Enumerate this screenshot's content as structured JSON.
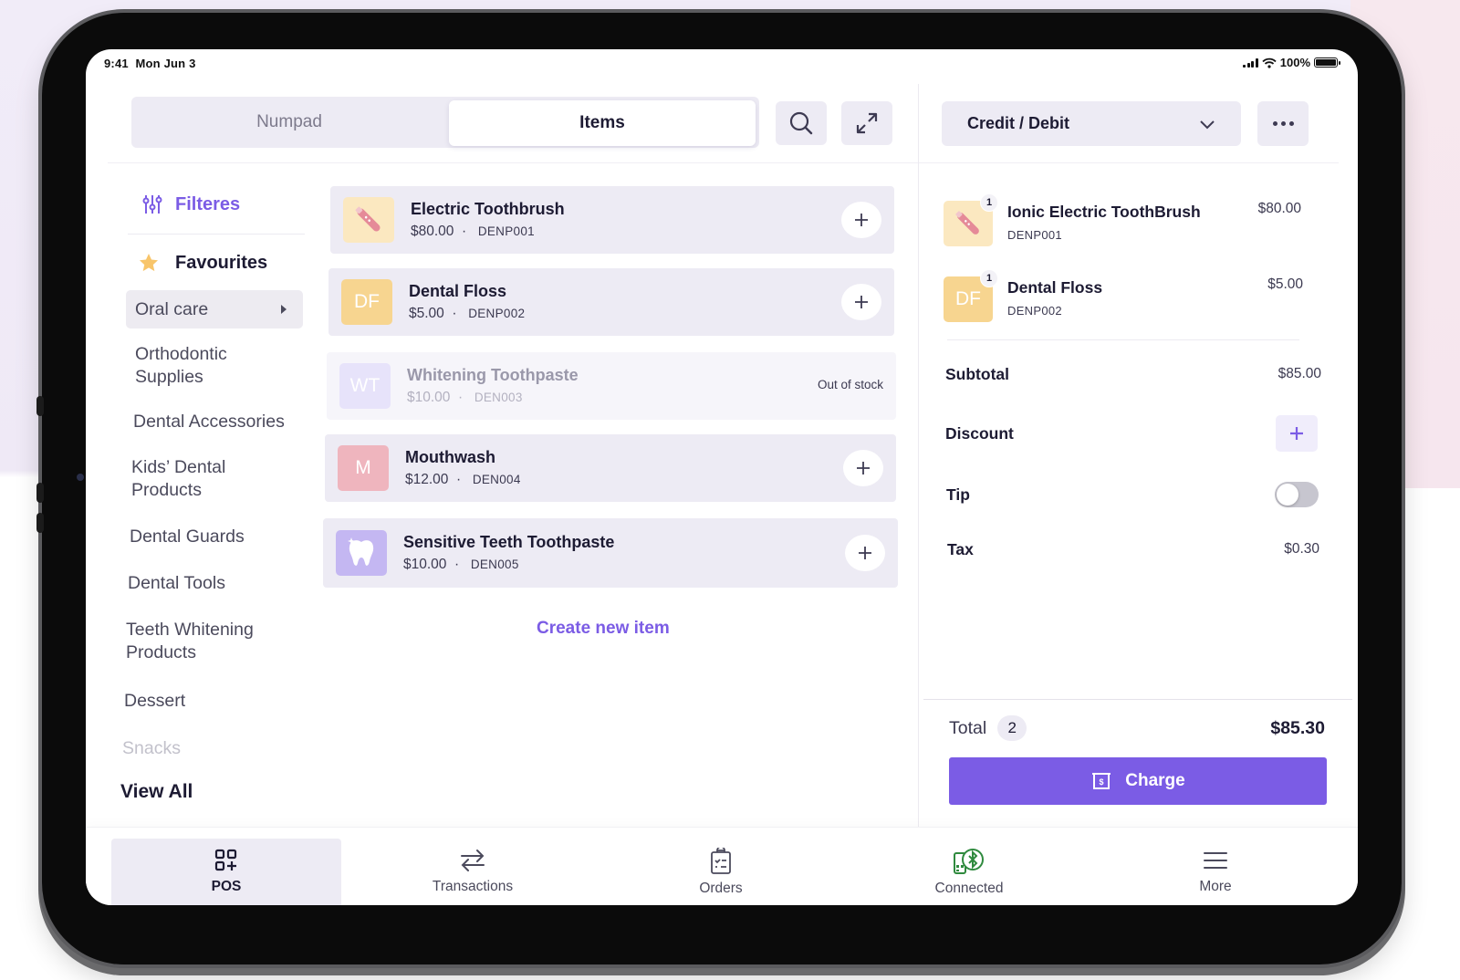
{
  "status_bar": {
    "time": "9:41",
    "date": "Mon Jun 3",
    "battery": "100%"
  },
  "top_bar": {
    "tabs": [
      {
        "label": "Numpad",
        "active": false
      },
      {
        "label": "Items",
        "active": true
      }
    ],
    "search_icon": "search-icon",
    "expand_icon": "expand-arrows-icon"
  },
  "payment": {
    "selected": "Credit / Debit",
    "more_icon": "ellipsis-icon"
  },
  "sidebar": {
    "filters_label": "Filteres",
    "favourites_label": "Favourites",
    "categories": [
      {
        "label": "Oral care",
        "active": true
      },
      {
        "label": "Orthodontic Supplies"
      },
      {
        "label": "Dental Accessories"
      },
      {
        "label": "Kids’ Dental Products"
      },
      {
        "label": "Dental Guards"
      },
      {
        "label": "Dental Tools"
      },
      {
        "label": "Teeth Whitening Products"
      },
      {
        "label": "Dessert"
      },
      {
        "label": "Snacks"
      }
    ],
    "view_all": "View All"
  },
  "products": [
    {
      "name": "Electric Toothbrush",
      "price": "$80.00",
      "sku": "DENP001",
      "thumb": "toothbrush-image",
      "initials": "",
      "color": "#fbe8c0",
      "in_stock": true
    },
    {
      "name": "Dental Floss",
      "price": "$5.00",
      "sku": "DENP002",
      "initials": "DF",
      "color": "#f7d590",
      "in_stock": true
    },
    {
      "name": "Whitening Toothpaste",
      "price": "$10.00",
      "sku": "DEN003",
      "initials": "WT",
      "color": "#e7e3fa",
      "in_stock": false,
      "status": "Out of stock"
    },
    {
      "name": "Mouthwash",
      "price": "$12.00",
      "sku": "DEN004",
      "initials": "M",
      "color": "#efb5be",
      "in_stock": true
    },
    {
      "name": "Sensitive Teeth Toothpaste",
      "price": "$10.00",
      "sku": "DEN005",
      "thumb": "tooth-image",
      "initials": "",
      "color": "#c4b7f2",
      "in_stock": true
    }
  ],
  "create_item": "Create new item",
  "cart": {
    "items": [
      {
        "name": "Ionic Electric ToothBrush",
        "sku": "DENP001",
        "price": "$80.00",
        "qty": "1"
      },
      {
        "name": "Dental Floss",
        "sku": "DENP002",
        "price": "$5.00",
        "qty": "1",
        "initials": "DF"
      }
    ],
    "subtotal_label": "Subtotal",
    "subtotal": "$85.00",
    "discount_label": "Discount",
    "tip_label": "Tip",
    "tip_enabled": false,
    "tax_label": "Tax",
    "tax": "$0.30",
    "total_label": "Total",
    "count": "2",
    "total": "$85.30",
    "charge_label": "Charge"
  },
  "bottom_nav": [
    {
      "label": "POS",
      "icon": "pos-grid-icon",
      "active": true
    },
    {
      "label": "Transactions",
      "icon": "swap-arrows-icon"
    },
    {
      "label": "Orders",
      "icon": "clipboard-icon"
    },
    {
      "label": "Connected",
      "icon": "bluetooth-terminal-icon"
    },
    {
      "label": "More",
      "icon": "menu-icon"
    }
  ],
  "colors": {
    "accent": "#7b5ce5",
    "connected": "#2f8a3e",
    "surface": "#edebf4"
  }
}
